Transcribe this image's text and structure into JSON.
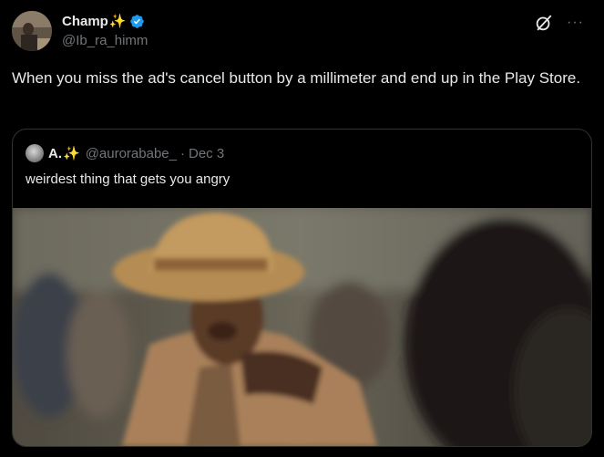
{
  "post": {
    "author": {
      "display_name": "Champ",
      "emoji": "✨",
      "handle": "@Ib_ra_himm",
      "verified": true
    },
    "icons": {
      "grok": "grok-icon",
      "more": "more-icon"
    },
    "text": "When you miss the ad's cancel button by a millimeter and end up in the Play Store."
  },
  "quote": {
    "author": {
      "display_name": "A.",
      "emoji": "✨",
      "handle": "@aurorababe_",
      "separator": "·",
      "date": "Dec 3"
    },
    "text": "weirdest thing that gets you angry",
    "media": {
      "type": "video-still"
    }
  },
  "colors": {
    "background": "#000000",
    "text": "#e7e9ea",
    "muted": "#71767b",
    "border": "#2f3336",
    "verified": "#1d9bf0",
    "sparkle": "#f4c430"
  }
}
